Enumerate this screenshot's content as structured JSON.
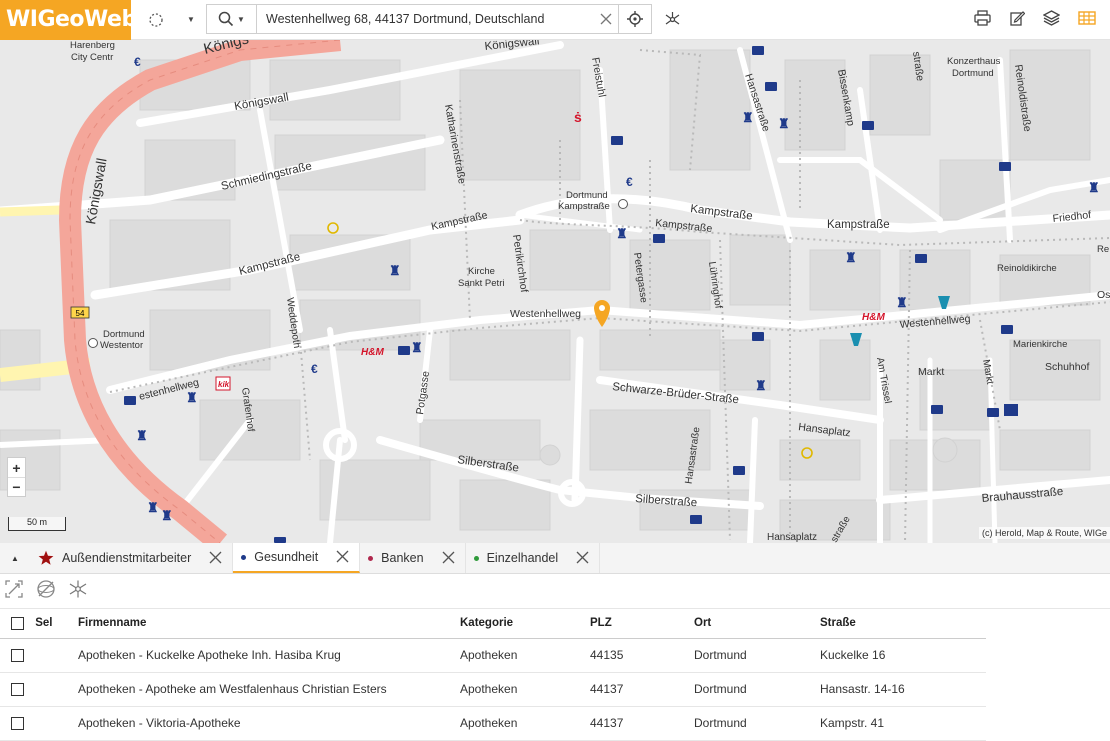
{
  "app": {
    "logo": "WIGeoWeb"
  },
  "search": {
    "value": "Westenhellweg 68, 44137 Dortmund, Deutschland"
  },
  "map": {
    "labels": {
      "koenigswall_top": "Königswall",
      "koenigswall_left": "Königswall",
      "koenigswall_road": "Königswall",
      "koenig_partial": "Königs",
      "harenberg": "Harenberg",
      "city_centr": "City Centr",
      "schmiedingstrasse": "Schmiedingstraße",
      "kampstrasse_left": "Kampstraße",
      "kampstrasse_mid": "Kampstraße",
      "kampstrasse_right1": "Kampstraße",
      "kampstrasse_right2": "Kampstraße",
      "kampstrasse_right3": "Kampstraße",
      "katharinenstrasse": "Katharinenstraße",
      "freistuhl": "Freistuhl",
      "hansastrasse_top": "Hansastraße",
      "hansastrasse_bottom": "Hansastraße",
      "bissenkamp": "Bissenkamp",
      "konzerthaus": "Konzerthaus",
      "konzerthaus2": "Dortmund",
      "reinoldistrasse": "Reinoldistraße",
      "friedhof": "Friedhof",
      "reinoldikirche": "Reinoldikirche",
      "dortmund_kampstrasse1": "Dortmund",
      "dortmund_kampstrasse2": "Kampstraße",
      "petrikirchhof": "Petrikirchhof",
      "kirche": "Kirche",
      "sankt_petri": "Sankt Petri",
      "petergasse": "Petergasse",
      "luehrinhof": "Lühringhof",
      "westenhellweg_mid": "Westenhellweg",
      "westenhellweg_right": "Westenhellweg",
      "westenhellweg_left": "estenhellweg",
      "weddepoth": "Weddepoth",
      "dortmund_westentor1": "Dortmund",
      "dortmund_westentor2": "Westentor",
      "grafenhof": "Grafenhof",
      "potgasse": "Potgasse",
      "silberstrasse_left": "Silberstraße",
      "silberstrasse_right": "Silberstraße",
      "schwarze_brueder": "Schwarze-Brüder-Straße",
      "hansaplatz": "Hansaplatz",
      "hansaplatz_bottom": "Hansaplatz",
      "am_trissel": "Am Trissel",
      "markt1": "Markt",
      "markt2": "Markt",
      "schuhhof": "Schuhhof",
      "marienkirche": "Marienkirche",
      "brauhausstrasse": "Brauhausstraße",
      "strasse_top": "straße",
      "os_partial": "Os",
      "re_partial": "Re",
      "b54": "54",
      "strasse_bottom": "straße"
    },
    "scale": "50 m",
    "attribution": "(c) Herold, Map & Route, WIGe",
    "zoom_in": "+",
    "zoom_out": "−",
    "colors": {
      "motorway": "#f4a69a",
      "highlight_yellow": "#fff5b0",
      "pin": "#f5a623",
      "poi_blue": "#1f3a8a",
      "poi_red": "#d4152b"
    }
  },
  "tabs": [
    {
      "label": "Außendienstmitarbeiter",
      "icon": "star-icon",
      "color": "#a01010",
      "active": false
    },
    {
      "label": "Gesundheit",
      "icon": "dot-icon",
      "color": "#1f3a8a",
      "active": true
    },
    {
      "label": "Banken",
      "icon": "dot-icon",
      "color": "#b0284d",
      "active": false
    },
    {
      "label": "Einzelhandel",
      "icon": "dot-icon",
      "color": "#2f9a3a",
      "active": false
    }
  ],
  "table": {
    "columns": [
      "Sel",
      "Firmenname",
      "Kategorie",
      "PLZ",
      "Ort",
      "Straße"
    ],
    "rows": [
      {
        "firmenname": "Apotheken - Kuckelke Apotheke Inh. Hasiba Krug",
        "kategorie": "Apotheken",
        "plz": "44135",
        "ort": "Dortmund",
        "strasse": "Kuckelke 16"
      },
      {
        "firmenname": "Apotheken - Apotheke am Westfalenhaus Christian Esters",
        "kategorie": "Apotheken",
        "plz": "44137",
        "ort": "Dortmund",
        "strasse": "Hansastr. 14-16"
      },
      {
        "firmenname": "Apotheken - Viktoria-Apotheke",
        "kategorie": "Apotheken",
        "plz": "44137",
        "ort": "Dortmund",
        "strasse": "Kampstr. 41"
      }
    ]
  }
}
